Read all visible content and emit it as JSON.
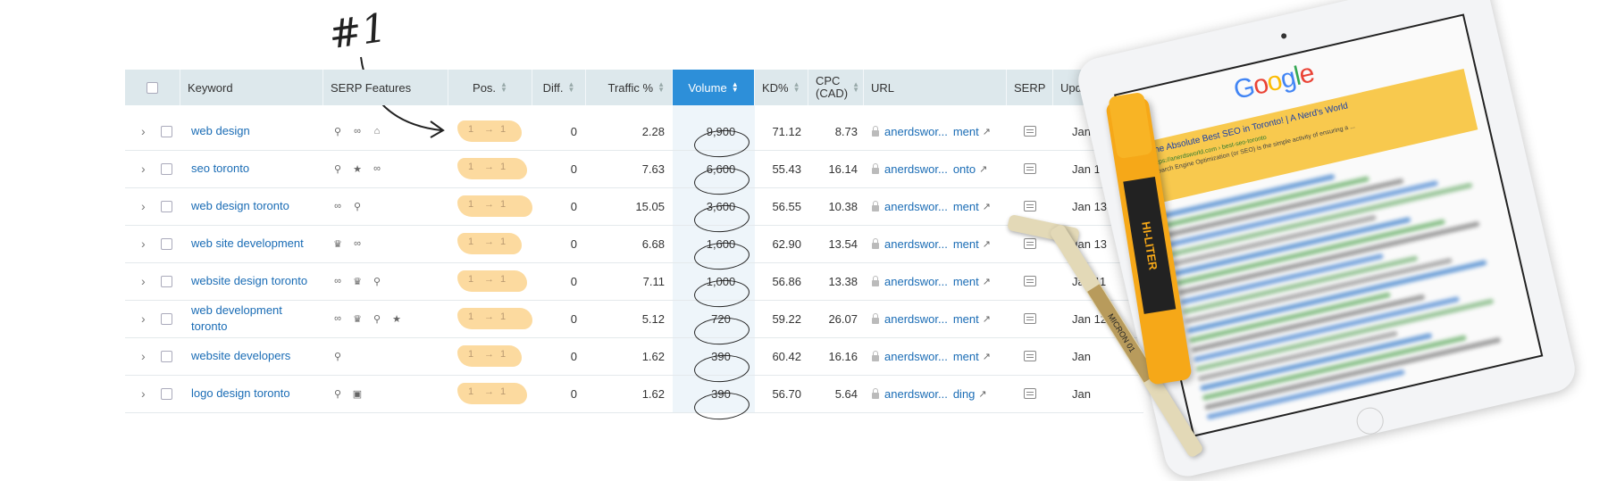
{
  "annotation": "#1",
  "columns": {
    "keyword": "Keyword",
    "serp_features": "SERP Features",
    "pos": "Pos.",
    "diff": "Diff.",
    "traffic": "Traffic %",
    "volume": "Volume",
    "kd": "KD%",
    "cpc_line1": "CPC",
    "cpc_line2": "(CAD)",
    "url": "URL",
    "serp": "SERP",
    "upd": "Upd."
  },
  "rows": [
    {
      "keyword": "web design",
      "pos_from": "1",
      "pos_to": "1",
      "diff": "0",
      "traffic": "2.28",
      "volume": "9,900",
      "kd": "71.12",
      "cpc": "8.73",
      "url_left": "anerdswor...",
      "url_right": "ment",
      "upd": "Jan 13"
    },
    {
      "keyword": "seo toronto",
      "pos_from": "1",
      "pos_to": "1",
      "diff": "0",
      "traffic": "7.63",
      "volume": "6,600",
      "kd": "55.43",
      "cpc": "16.14",
      "url_left": "anerdswor...",
      "url_right": "onto",
      "upd": "Jan 13"
    },
    {
      "keyword": "web design toronto",
      "pos_from": "1",
      "pos_to": "1",
      "diff": "0",
      "traffic": "15.05",
      "volume": "3,600",
      "kd": "56.55",
      "cpc": "10.38",
      "url_left": "anerdswor...",
      "url_right": "ment",
      "upd": "Jan 13"
    },
    {
      "keyword": "web site development",
      "pos_from": "1",
      "pos_to": "1",
      "diff": "0",
      "traffic": "6.68",
      "volume": "1,600",
      "kd": "62.90",
      "cpc": "13.54",
      "url_left": "anerdswor...",
      "url_right": "ment",
      "upd": "Jan 13"
    },
    {
      "keyword": "website design toronto",
      "pos_from": "1",
      "pos_to": "1",
      "diff": "0",
      "traffic": "7.11",
      "volume": "1,000",
      "kd": "56.86",
      "cpc": "13.38",
      "url_left": "anerdswor...",
      "url_right": "ment",
      "upd": "Jan 11"
    },
    {
      "keyword": "web development toronto",
      "pos_from": "1",
      "pos_to": "1",
      "diff": "0",
      "traffic": "5.12",
      "volume": "720",
      "kd": "59.22",
      "cpc": "26.07",
      "url_left": "anerdswor...",
      "url_right": "ment",
      "upd": "Jan 12"
    },
    {
      "keyword": "website developers",
      "pos_from": "1",
      "pos_to": "1",
      "diff": "0",
      "traffic": "1.62",
      "volume": "390",
      "kd": "60.42",
      "cpc": "16.16",
      "url_left": "anerdswor...",
      "url_right": "ment",
      "upd": "Jan"
    },
    {
      "keyword": "logo design toronto",
      "pos_from": "1",
      "pos_to": "1",
      "diff": "0",
      "traffic": "1.62",
      "volume": "390",
      "kd": "56.70",
      "cpc": "5.64",
      "url_left": "anerdswor...",
      "url_right": "ding",
      "upd": "Jan"
    }
  ],
  "serp_icons": [
    [
      "map-pin-icon",
      "link-icon",
      "graduation-cap-icon"
    ],
    [
      "map-pin-icon",
      "star-icon",
      "link-icon"
    ],
    [
      "link-icon",
      "map-pin-icon"
    ],
    [
      "crown-icon",
      "link-icon"
    ],
    [
      "link-icon",
      "crown-icon",
      "map-pin-icon"
    ],
    [
      "link-icon",
      "crown-icon",
      "map-pin-icon",
      "star-icon"
    ],
    [
      "map-pin-icon"
    ],
    [
      "map-pin-icon",
      "image-icon"
    ]
  ],
  "tablet": {
    "logo": "Google",
    "result_title": "The Absolute Best SEO in Toronto! | A Nerd's World",
    "result_url": "https://anerdsworld.com › best-seo-toronto",
    "result_snippet": "Search Engine Optimization (or SEO) is the simple activity of ensuring a ..."
  },
  "marker": {
    "brand": "HI-LITER"
  },
  "pen": {
    "brand": "MICRON 01"
  },
  "colors": {
    "active_header": "#2d8fd9",
    "link": "#1a6cb5",
    "highlight": "#fcd99a",
    "header_bg": "#dde8ec"
  }
}
